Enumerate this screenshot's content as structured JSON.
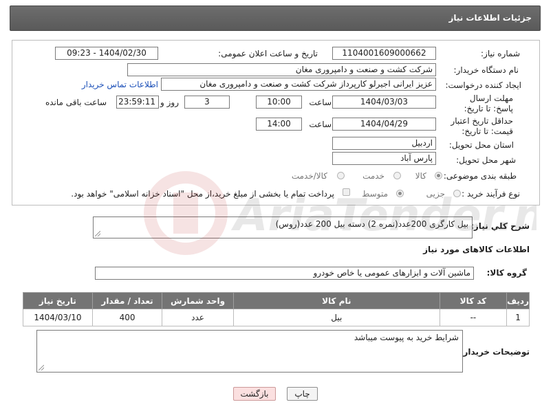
{
  "header": {
    "title": "جزئیات اطلاعات نیاز"
  },
  "fields": {
    "need_number_label": "شماره نیاز:",
    "need_number": "1104001609000662",
    "announce_label": "تاریخ و ساعت اعلان عمومی:",
    "announce_value": "1404/02/30 - 09:23",
    "buyer_org_label": "نام دستگاه خریدار:",
    "buyer_org": "شرکت کشت و صنعت و دامپروری مغان",
    "creator_label": "ایجاد کننده درخواست:",
    "creator": "عزیز ایرانی اجیرلو کارپرداز شرکت کشت و صنعت و دامپروری مغان",
    "contact_link": "اطلاعات تماس خریدار",
    "deadline_label": "مهلت ارسال پاسخ: تا تاریخ:",
    "deadline_date": "1404/03/03",
    "time_label": "ساعت",
    "deadline_time": "10:00",
    "days_value": "3",
    "day_and_label": "روز و",
    "remaining_time": "23:59:11",
    "remaining_label": "ساعت باقی مانده",
    "validity_label": "حداقل تاریخ اعتبار قیمت: تا تاریخ:",
    "validity_date": "1404/04/29",
    "validity_time": "14:00",
    "province_label": "استان محل تحویل:",
    "province": "اردبیل",
    "city_label": "شهر محل تحویل:",
    "city": "پارس آباد",
    "category_label": "طبقه بندی موضوعی:",
    "category_options": [
      "کالا",
      "خدمت",
      "کالا/خدمت"
    ],
    "process_label": "نوع فرآیند خرید :",
    "process_options": [
      "جزیی",
      "متوسط"
    ],
    "payment_note": "پرداخت تمام یا بخشی از مبلغ خرید،از محل \"اسناد خزانه اسلامی\" خواهد بود."
  },
  "description": {
    "label": "شرح کلي نياز:",
    "value": "بیل کارگری 200عدد(نمره 2) دسته بیل 200 عدد(روس)"
  },
  "goods": {
    "section_title": "اطلاعات کالاهای مورد نیاز",
    "group_label": "گروه کالا:",
    "group_value": "ماشین آلات و ابزارهای عمومی یا خاص خودرو",
    "columns": [
      "ردیف",
      "کد کالا",
      "نام کالا",
      "واحد شمارش",
      "تعداد / مقدار",
      "تاریخ نیاز"
    ],
    "rows": [
      {
        "idx": "1",
        "code": "--",
        "name": "بیل",
        "unit": "عدد",
        "qty": "400",
        "date": "1404/03/10"
      }
    ]
  },
  "buyer_notes": {
    "label": "توضیحات خریدار:",
    "value": "شرایط خرید به پیوست میباشد"
  },
  "buttons": {
    "print": "چاپ",
    "back": "بازگشت"
  },
  "watermark": {
    "text": "AriaTender.neT"
  },
  "colors": {
    "header_bg": "#5f5f5f",
    "table_header_bg": "#747474",
    "link": "#1b4fb8",
    "back_button_bg": "#fbe0e0"
  }
}
